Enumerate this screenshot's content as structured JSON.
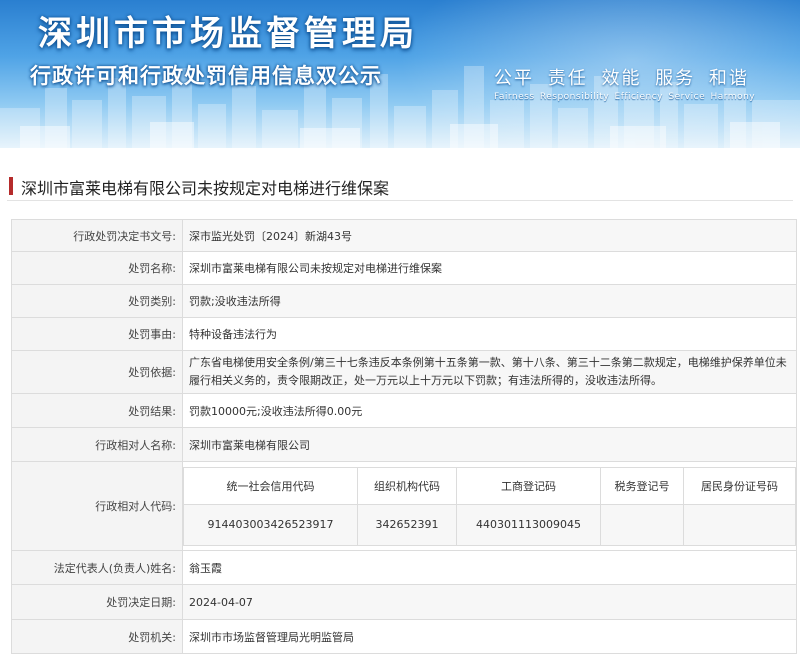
{
  "banner": {
    "title": "深圳市市场监督管理局",
    "subtitle": "行政许可和行政处罚信用信息双公示",
    "slogan_cn": "公平  责任  效能  服务  和谐",
    "slogan_en": "Fairness  Responsibility  Efficiency  Service  Harmony"
  },
  "document": {
    "heading": "深圳市富莱电梯有限公司未按规定对电梯进行维保案"
  },
  "fields": {
    "doc_no": {
      "label": "行政处罚决定书文号:",
      "value": "深市监光处罚〔2024〕新湖43号"
    },
    "case_name": {
      "label": "处罚名称:",
      "value": "深圳市富莱电梯有限公司未按规定对电梯进行维保案"
    },
    "category": {
      "label": "处罚类别:",
      "value": "罚款;没收违法所得"
    },
    "reason": {
      "label": "处罚事由:",
      "value": "特种设备违法行为"
    },
    "basis": {
      "label": "处罚依据:",
      "value": "广东省电梯使用安全条例/第三十七条违反本条例第十五条第一款、第十八条、第三十二条第二款规定，电梯维护保养单位未履行相关义务的，责令限期改正，处一万元以上十万元以下罚款；有违法所得的，没收违法所得。"
    },
    "result": {
      "label": "处罚结果:",
      "value": "罚款10000元;没收违法所得0.00元"
    },
    "party": {
      "label": "行政相对人名称:",
      "value": "深圳市富莱电梯有限公司"
    },
    "codes": {
      "label": "行政相对人代码:",
      "headers": [
        "统一社会信用代码",
        "组织机构代码",
        "工商登记码",
        "税务登记号",
        "居民身份证号码"
      ],
      "values": [
        "914403003426523917",
        "342652391",
        "440301113009045",
        "",
        ""
      ]
    },
    "legal_rep": {
      "label": "法定代表人(负责人)姓名:",
      "value": "翁玉霞"
    },
    "date": {
      "label": "处罚决定日期:",
      "value": "2024-04-07"
    },
    "authority": {
      "label": "处罚机关:",
      "value": "深圳市市场监督管理局光明监管局"
    }
  }
}
